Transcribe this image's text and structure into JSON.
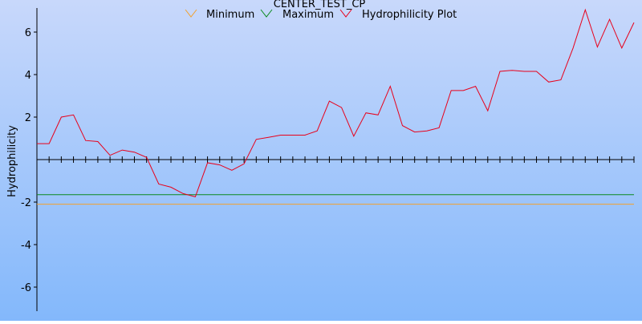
{
  "chart_data": {
    "type": "line",
    "title": "CENTER_TEST_CP",
    "xlabel": "",
    "ylabel": "Hydrophilicity",
    "ylim": [
      -7.2,
      7.2
    ],
    "yticks": [
      -6,
      -4,
      -2,
      2,
      4,
      6
    ],
    "grid": false,
    "legend_position": "top",
    "series": [
      {
        "name": "Minimum",
        "color": "#f2a12d",
        "kind": "constant",
        "value": -2.1
      },
      {
        "name": "Maximum",
        "color": "#0a8a1e",
        "kind": "constant",
        "value": -1.65
      },
      {
        "name": "Hydrophilicity Plot",
        "color": "#e8001a",
        "kind": "line",
        "x": [
          1,
          2,
          3,
          4,
          5,
          6,
          7,
          8,
          9,
          10,
          11,
          12,
          13,
          14,
          15,
          16,
          17,
          18,
          19,
          20,
          21,
          22,
          23,
          24,
          25,
          26,
          27,
          28,
          29,
          30,
          31,
          32,
          33,
          34,
          35,
          36,
          37,
          38,
          39,
          40,
          41,
          42,
          43,
          44,
          45,
          46,
          47,
          48,
          49,
          50
        ],
        "values": [
          0.75,
          0.75,
          2.0,
          2.1,
          0.9,
          0.85,
          0.2,
          0.45,
          0.35,
          0.1,
          -1.15,
          -1.3,
          -1.6,
          -1.75,
          -0.15,
          -0.25,
          -0.5,
          -0.2,
          0.95,
          1.05,
          1.15,
          1.15,
          1.15,
          1.35,
          2.75,
          2.45,
          1.1,
          2.2,
          2.1,
          3.45,
          1.6,
          1.3,
          1.35,
          1.5,
          3.25,
          3.25,
          3.45,
          2.3,
          4.15,
          4.2,
          4.15,
          4.15,
          3.65,
          3.75,
          5.25,
          7.05,
          5.3,
          6.6,
          5.25,
          6.45
        ]
      }
    ]
  }
}
